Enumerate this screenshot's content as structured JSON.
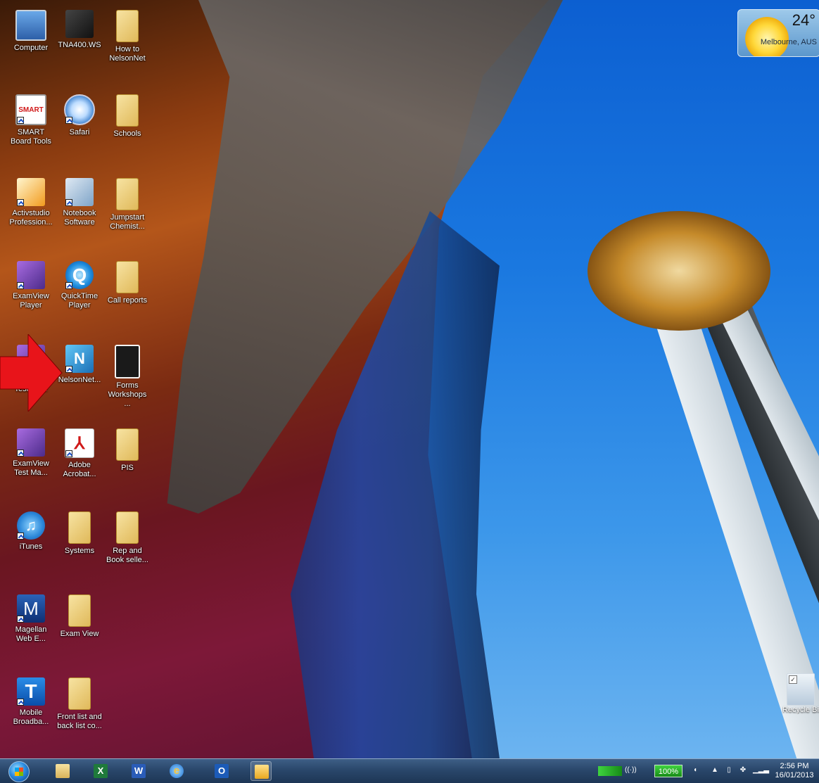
{
  "desktop": {
    "icons": [
      {
        "label": "Computer"
      },
      {
        "label": "TNA400.WS"
      },
      {
        "label": "How to NelsonNet"
      },
      {
        "label": "SMART Board Tools"
      },
      {
        "label": "Safari"
      },
      {
        "label": "Schools"
      },
      {
        "label": "Activstudio Profession..."
      },
      {
        "label": "Notebook Software"
      },
      {
        "label": "Jumpstart Chemist..."
      },
      {
        "label": "ExamView Player"
      },
      {
        "label": "QuickTime Player"
      },
      {
        "label": "Call reports"
      },
      {
        "label": "ExamView Test Ge..."
      },
      {
        "label": "NelsonNet..."
      },
      {
        "label": "Forms Workshops ..."
      },
      {
        "label": "ExamView Test Ma..."
      },
      {
        "label": "Adobe Acrobat..."
      },
      {
        "label": "PIS"
      },
      {
        "label": "iTunes"
      },
      {
        "label": "Systems"
      },
      {
        "label": "Rep and Book selle..."
      },
      {
        "label": "Magellan Web E..."
      },
      {
        "label": "Exam View"
      },
      {
        "label": "Mobile Broadba..."
      },
      {
        "label": "Front list and back list co..."
      }
    ],
    "recycle_bin": {
      "label": "Recycle Bin"
    }
  },
  "weather": {
    "temperature": "24°",
    "location": "Melbourne, AUS"
  },
  "taskbar": {
    "battery": "100%",
    "time": "2:56 PM",
    "date": "16/01/2013"
  },
  "colors": {
    "taskbar": "#2a476b",
    "arrow": "#e8141a",
    "sky": "#1a78e0"
  }
}
